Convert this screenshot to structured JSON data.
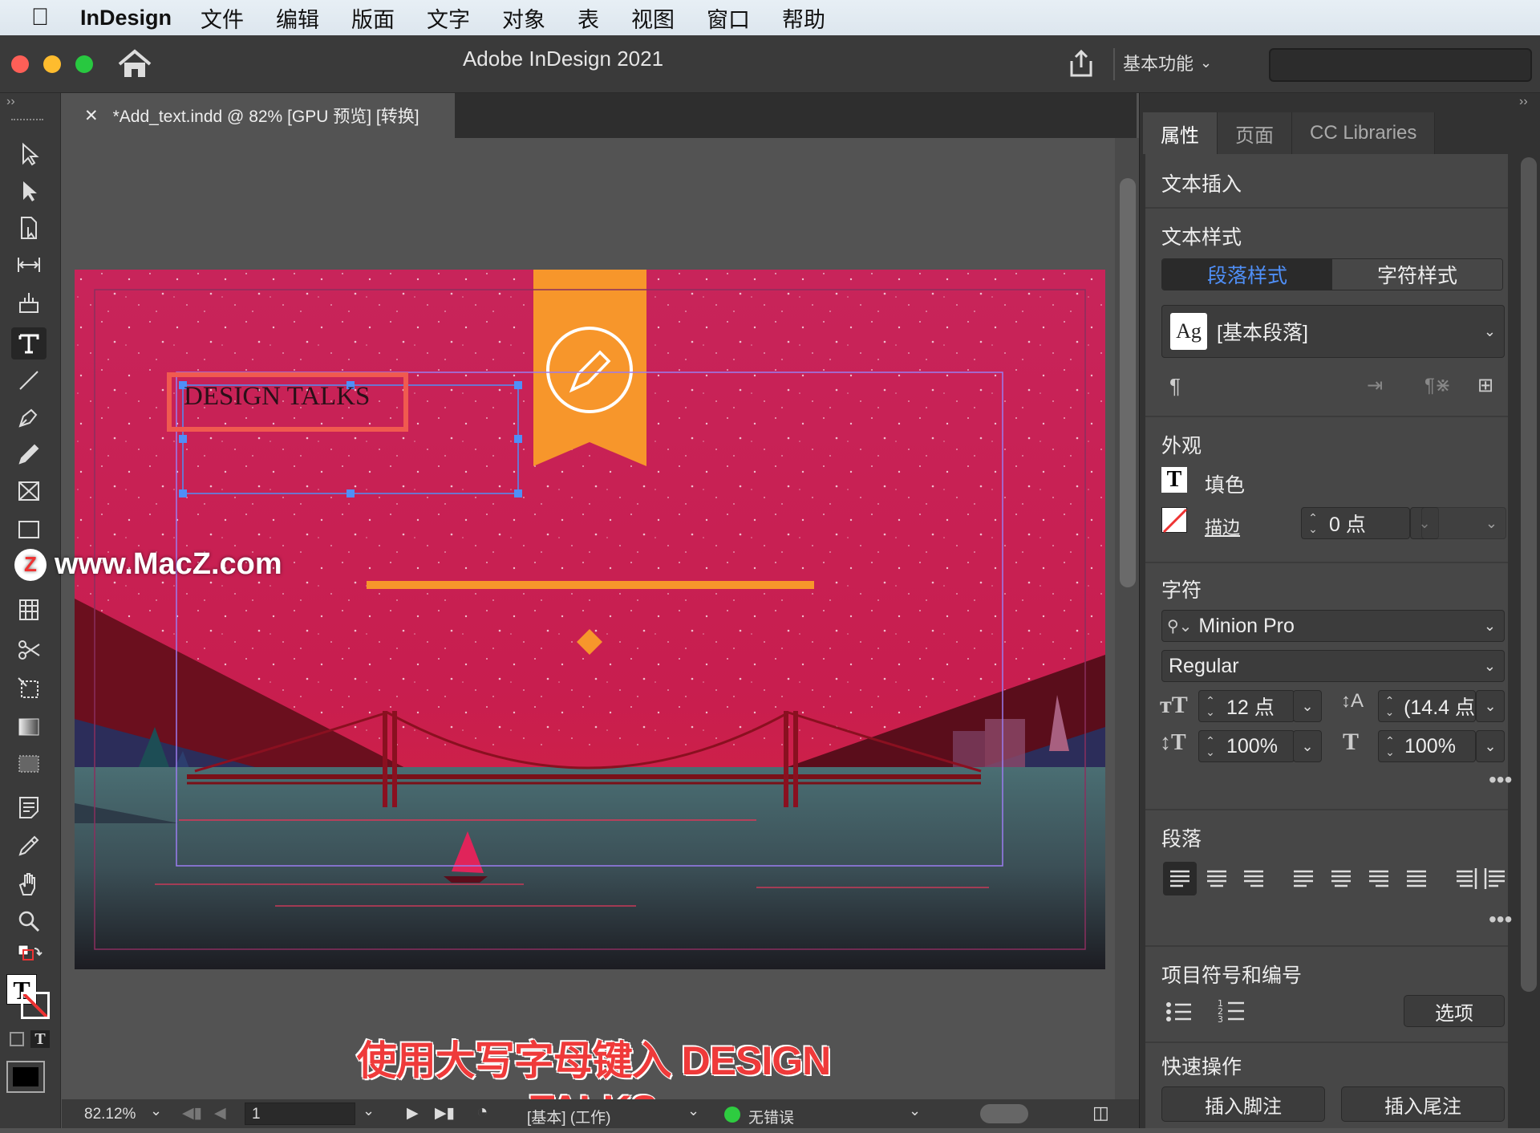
{
  "menubar": {
    "app_name": "InDesign",
    "items": [
      "文件",
      "编辑",
      "版面",
      "文字",
      "对象",
      "表",
      "视图",
      "窗口",
      "帮助"
    ]
  },
  "window": {
    "title": "Adobe InDesign 2021",
    "workspace": "基本功能"
  },
  "document": {
    "tab_title": "*Add_text.indd @ 82% [GPU 预览] [转换]",
    "text_frame_content": "DESIGN TALKS"
  },
  "statusbar": {
    "zoom": "82.12%",
    "page": "1",
    "style": "[基本] (工作)",
    "preflight": "无错误"
  },
  "panel": {
    "tabs": [
      "属性",
      "页面",
      "CC Libraries"
    ],
    "text_insert": "文本插入",
    "text_style": {
      "title": "文本样式",
      "seg_paragraph": "段落样式",
      "seg_character": "字符样式",
      "current": "[基本段落]"
    },
    "appearance": {
      "title": "外观",
      "fill_label": "填色",
      "stroke_label": "描边",
      "stroke_value": "0 点"
    },
    "character": {
      "title": "字符",
      "font": "Minion Pro",
      "style": "Regular",
      "size": "12 点",
      "leading": "(14.4 点",
      "vscale": "100%",
      "hscale": "100%"
    },
    "paragraph": {
      "title": "段落"
    },
    "bullets": {
      "title": "项目符号和编号",
      "options_label": "选项"
    },
    "quick_actions": {
      "title": "快速操作",
      "footnote_label": "插入脚注",
      "endnote_label": "插入尾注"
    }
  },
  "overlay": {
    "watermark": "www.MacZ.com",
    "caption": "使用大写字母键入 DESIGN TALKS"
  },
  "colors": {
    "accent": "#4f8ff7",
    "page_pink": "#c8245a",
    "ribbon_orange": "#f7962b",
    "highlight_red": "#f05a4f"
  }
}
